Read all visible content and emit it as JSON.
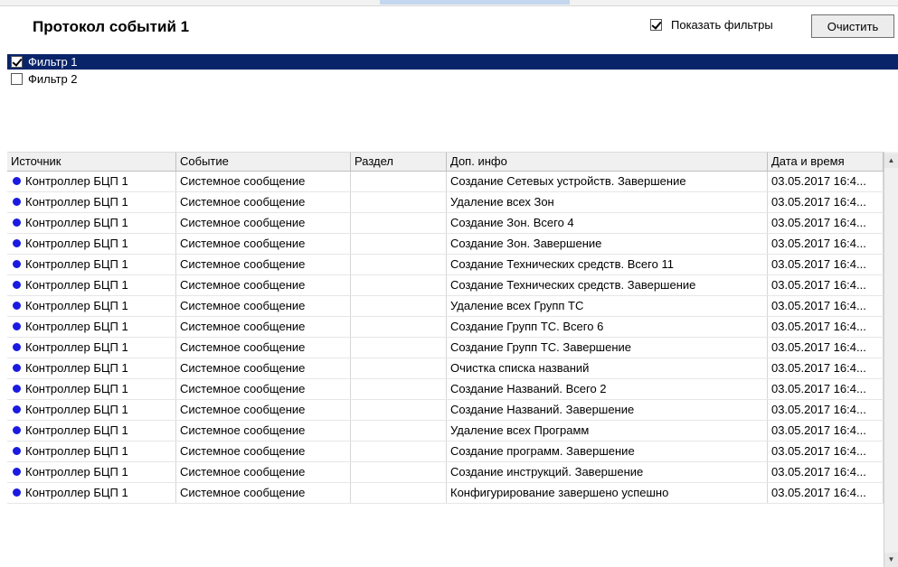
{
  "title": "Протокол событий 1",
  "show_filters": {
    "label": "Показать фильтры",
    "checked": true
  },
  "clear_button": "Очистить",
  "filters": [
    {
      "label": "Фильтр 1",
      "checked": true,
      "selected": true
    },
    {
      "label": "Фильтр 2",
      "checked": false,
      "selected": false
    }
  ],
  "table": {
    "columns": [
      "Источник",
      "Событие",
      "Раздел",
      "Доп. инфо",
      "Дата и время"
    ],
    "rows": [
      {
        "source": "Контроллер БЦП 1",
        "event": "Системное сообщение",
        "section": "",
        "info": "Создание Сетевых устройств. Завершение",
        "datetime": "03.05.2017 16:4..."
      },
      {
        "source": "Контроллер БЦП 1",
        "event": "Системное сообщение",
        "section": "",
        "info": "Удаление всех Зон",
        "datetime": "03.05.2017 16:4..."
      },
      {
        "source": "Контроллер БЦП 1",
        "event": "Системное сообщение",
        "section": "",
        "info": "Создание Зон. Всего 4",
        "datetime": "03.05.2017 16:4..."
      },
      {
        "source": "Контроллер БЦП 1",
        "event": "Системное сообщение",
        "section": "",
        "info": "Создание Зон. Завершение",
        "datetime": "03.05.2017 16:4..."
      },
      {
        "source": "Контроллер БЦП 1",
        "event": "Системное сообщение",
        "section": "",
        "info": "Создание Технических средств. Всего 11",
        "datetime": "03.05.2017 16:4..."
      },
      {
        "source": "Контроллер БЦП 1",
        "event": "Системное сообщение",
        "section": "",
        "info": "Создание Технических средств. Завершение",
        "datetime": "03.05.2017 16:4..."
      },
      {
        "source": "Контроллер БЦП 1",
        "event": "Системное сообщение",
        "section": "",
        "info": "Удаление всех Групп ТС",
        "datetime": "03.05.2017 16:4..."
      },
      {
        "source": "Контроллер БЦП 1",
        "event": "Системное сообщение",
        "section": "",
        "info": "Создание Групп ТС. Всего 6",
        "datetime": "03.05.2017 16:4..."
      },
      {
        "source": "Контроллер БЦП 1",
        "event": "Системное сообщение",
        "section": "",
        "info": "Создание Групп ТС. Завершение",
        "datetime": "03.05.2017 16:4..."
      },
      {
        "source": "Контроллер БЦП 1",
        "event": "Системное сообщение",
        "section": "",
        "info": "Очистка списка названий",
        "datetime": "03.05.2017 16:4..."
      },
      {
        "source": "Контроллер БЦП 1",
        "event": "Системное сообщение",
        "section": "",
        "info": "Создание Названий. Всего 2",
        "datetime": "03.05.2017 16:4..."
      },
      {
        "source": "Контроллер БЦП 1",
        "event": "Системное сообщение",
        "section": "",
        "info": "Создание Названий. Завершение",
        "datetime": "03.05.2017 16:4..."
      },
      {
        "source": "Контроллер БЦП 1",
        "event": "Системное сообщение",
        "section": "",
        "info": "Удаление всех Программ",
        "datetime": "03.05.2017 16:4..."
      },
      {
        "source": "Контроллер БЦП 1",
        "event": "Системное сообщение",
        "section": "",
        "info": "Создание программ. Завершение",
        "datetime": "03.05.2017 16:4..."
      },
      {
        "source": "Контроллер БЦП 1",
        "event": "Системное сообщение",
        "section": "",
        "info": "Создание инструкций. Завершение",
        "datetime": "03.05.2017 16:4..."
      },
      {
        "source": "Контроллер БЦП 1",
        "event": "Системное сообщение",
        "section": "",
        "info": "Конфигурирование завершено успешно",
        "datetime": "03.05.2017 16:4..."
      }
    ]
  },
  "colors": {
    "selection": "#0a246a",
    "source_dot": "#1a1ae0"
  },
  "icons": {
    "source_status": "blue-dot-icon",
    "scroll_up": "arrow-up-icon",
    "scroll_down": "arrow-down-icon"
  }
}
